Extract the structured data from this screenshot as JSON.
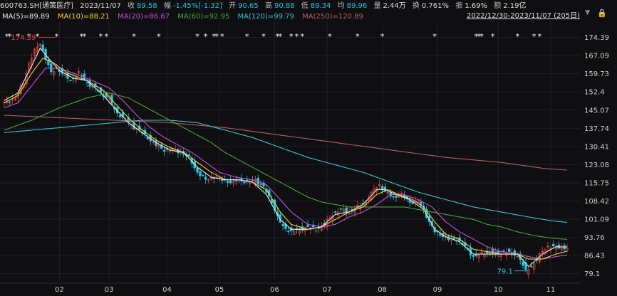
{
  "header": {
    "symbol": "600763.SH[通策医疗]",
    "date": "2023/11/07",
    "close_label": "收",
    "close": "89.58",
    "change_label": "幅",
    "change": "-1.45%[-1.32]",
    "open_label": "开",
    "open": "90.65",
    "high_label": "高",
    "high": "90.88",
    "low_label": "低",
    "low": "89.34",
    "avg_label": "均",
    "avg": "89.96",
    "vol_label": "量",
    "vol": "2.44万",
    "turnover_label": "换",
    "turnover": "0.761%",
    "amp_label": "振",
    "amp": "1.69%",
    "amount_label": "额",
    "amount": "2.19亿"
  },
  "range": {
    "label": "2022/12/30-2023/11/07 (205日)"
  },
  "icons": {
    "dropdown": "triangle-down-icon",
    "lock": "lock-icon"
  },
  "colors": {
    "up": "#e2473b",
    "down": "#22c5dc",
    "ma5": "#e6e6e6",
    "ma10": "#f0d23c",
    "ma20": "#c94fd8",
    "ma60": "#4da33a",
    "ma120": "#3cc3cf",
    "ma250": "#b86060",
    "background": "#0f0f12"
  },
  "chart_data": {
    "type": "candlestick",
    "ylim": [
      77,
      178
    ],
    "yticks": [
      "174.39",
      "167.09",
      "159.73",
      "152.4",
      "145.07",
      "137.74",
      "130.41",
      "123.08",
      "115.75",
      "108.42",
      "101.09",
      "93.76",
      "86.43",
      "79.1"
    ],
    "xticks": [
      {
        "label": "02",
        "x": 20
      },
      {
        "label": "03",
        "x": 38
      },
      {
        "label": "04",
        "x": 59
      },
      {
        "label": "05",
        "x": 78
      },
      {
        "label": "06",
        "x": 98
      },
      {
        "label": "07",
        "x": 117
      },
      {
        "label": "08",
        "x": 137
      },
      {
        "label": "09",
        "x": 157
      },
      {
        "label": "10",
        "x": 179
      },
      {
        "label": "11",
        "x": 198
      }
    ],
    "annotations": [
      {
        "text": "174.39",
        "x": 12,
        "y": 174.39,
        "color": "#e2473b"
      },
      {
        "text": "79.1",
        "x": 190,
        "y": 79.1,
        "color": "#22c5dc"
      }
    ],
    "event_markers_x": [
      1,
      2,
      5,
      9,
      12,
      19,
      28,
      29,
      35,
      37,
      47,
      56,
      70,
      73,
      76,
      77,
      79,
      88,
      94,
      99,
      100,
      104,
      106,
      108,
      118,
      128,
      137,
      156,
      171,
      172,
      173,
      177,
      186,
      192,
      194
    ],
    "ma_legend": [
      {
        "name": "MA(5)",
        "value": "89.89"
      },
      {
        "name": "MA(10)",
        "value": "88.21"
      },
      {
        "name": "MA(20)",
        "value": "86.67"
      },
      {
        "name": "MA(60)",
        "value": "92.95"
      },
      {
        "name": "MA(120)",
        "value": "99.79"
      },
      {
        "name": "MA(250)",
        "value": "120.89"
      }
    ],
    "close_anchors": [
      [
        0,
        148
      ],
      [
        4,
        150
      ],
      [
        7,
        156
      ],
      [
        9,
        164
      ],
      [
        11,
        169
      ],
      [
        13,
        172
      ],
      [
        15,
        166
      ],
      [
        17,
        160
      ],
      [
        19,
        162
      ],
      [
        21,
        160
      ],
      [
        24,
        157
      ],
      [
        27,
        160
      ],
      [
        30,
        156
      ],
      [
        33,
        154
      ],
      [
        36,
        151
      ],
      [
        38,
        150
      ],
      [
        40,
        145
      ],
      [
        43,
        142
      ],
      [
        46,
        139
      ],
      [
        49,
        137
      ],
      [
        52,
        134
      ],
      [
        55,
        131
      ],
      [
        58,
        129
      ],
      [
        61,
        129
      ],
      [
        64,
        128
      ],
      [
        67,
        126
      ],
      [
        70,
        120
      ],
      [
        73,
        117
      ],
      [
        76,
        118
      ],
      [
        79,
        117
      ],
      [
        82,
        116
      ],
      [
        85,
        117
      ],
      [
        88,
        116
      ],
      [
        91,
        117
      ],
      [
        94,
        114
      ],
      [
        97,
        108
      ],
      [
        99,
        102
      ],
      [
        101,
        98
      ],
      [
        104,
        96
      ],
      [
        107,
        97
      ],
      [
        110,
        98
      ],
      [
        113,
        97
      ],
      [
        116,
        99
      ],
      [
        119,
        103
      ],
      [
        122,
        105
      ],
      [
        125,
        104
      ],
      [
        128,
        106
      ],
      [
        131,
        108
      ],
      [
        134,
        113
      ],
      [
        136,
        115
      ],
      [
        138,
        112
      ],
      [
        141,
        110
      ],
      [
        144,
        111
      ],
      [
        147,
        108
      ],
      [
        150,
        108
      ],
      [
        152,
        105
      ],
      [
        154,
        100
      ],
      [
        156,
        96
      ],
      [
        158,
        95
      ],
      [
        161,
        93
      ],
      [
        164,
        93
      ],
      [
        167,
        90
      ],
      [
        170,
        86
      ],
      [
        173,
        87
      ],
      [
        176,
        88
      ],
      [
        179,
        87
      ],
      [
        182,
        88
      ],
      [
        185,
        87
      ],
      [
        187,
        85
      ],
      [
        189,
        80
      ],
      [
        191,
        82
      ],
      [
        193,
        85
      ],
      [
        195,
        88
      ],
      [
        197,
        90
      ],
      [
        199,
        90
      ],
      [
        201,
        89.6
      ],
      [
        204,
        89.58
      ]
    ],
    "ma5_anchors": [
      [
        0,
        149
      ],
      [
        5,
        152
      ],
      [
        10,
        163
      ],
      [
        13,
        170
      ],
      [
        16,
        166
      ],
      [
        20,
        161
      ],
      [
        25,
        158
      ],
      [
        30,
        157
      ],
      [
        35,
        152
      ],
      [
        40,
        146
      ],
      [
        45,
        140
      ],
      [
        50,
        136
      ],
      [
        55,
        132
      ],
      [
        60,
        129
      ],
      [
        65,
        128
      ],
      [
        70,
        122
      ],
      [
        75,
        118
      ],
      [
        80,
        117
      ],
      [
        85,
        117
      ],
      [
        90,
        116
      ],
      [
        95,
        111
      ],
      [
        100,
        101
      ],
      [
        104,
        97
      ],
      [
        110,
        97
      ],
      [
        115,
        98
      ],
      [
        120,
        103
      ],
      [
        125,
        104
      ],
      [
        130,
        107
      ],
      [
        135,
        113
      ],
      [
        138,
        113
      ],
      [
        142,
        111
      ],
      [
        147,
        109
      ],
      [
        152,
        105
      ],
      [
        156,
        97
      ],
      [
        160,
        94
      ],
      [
        165,
        92
      ],
      [
        170,
        87
      ],
      [
        175,
        87
      ],
      [
        180,
        87
      ],
      [
        186,
        87
      ],
      [
        190,
        82
      ],
      [
        195,
        87
      ],
      [
        200,
        90
      ],
      [
        204,
        89.89
      ]
    ],
    "ma10_anchors": [
      [
        0,
        148
      ],
      [
        5,
        151
      ],
      [
        10,
        160
      ],
      [
        14,
        166
      ],
      [
        18,
        164
      ],
      [
        23,
        160
      ],
      [
        30,
        157
      ],
      [
        36,
        153
      ],
      [
        40,
        148
      ],
      [
        45,
        142
      ],
      [
        50,
        137
      ],
      [
        55,
        133
      ],
      [
        60,
        130
      ],
      [
        65,
        128
      ],
      [
        70,
        124
      ],
      [
        75,
        120
      ],
      [
        80,
        117
      ],
      [
        85,
        117
      ],
      [
        90,
        116
      ],
      [
        95,
        113
      ],
      [
        100,
        104
      ],
      [
        104,
        99
      ],
      [
        110,
        97
      ],
      [
        115,
        98
      ],
      [
        120,
        101
      ],
      [
        125,
        104
      ],
      [
        130,
        106
      ],
      [
        135,
        111
      ],
      [
        139,
        113
      ],
      [
        143,
        111
      ],
      [
        148,
        109
      ],
      [
        152,
        106
      ],
      [
        156,
        100
      ],
      [
        160,
        95
      ],
      [
        165,
        93
      ],
      [
        170,
        89
      ],
      [
        175,
        88
      ],
      [
        180,
        87
      ],
      [
        186,
        87
      ],
      [
        190,
        85
      ],
      [
        195,
        85
      ],
      [
        200,
        87
      ],
      [
        204,
        88.21
      ]
    ],
    "ma20_anchors": [
      [
        0,
        146
      ],
      [
        5,
        148
      ],
      [
        10,
        155
      ],
      [
        15,
        162
      ],
      [
        20,
        162
      ],
      [
        25,
        160
      ],
      [
        32,
        157
      ],
      [
        38,
        154
      ],
      [
        43,
        149
      ],
      [
        48,
        143
      ],
      [
        53,
        138
      ],
      [
        58,
        134
      ],
      [
        63,
        131
      ],
      [
        68,
        128
      ],
      [
        73,
        124
      ],
      [
        78,
        120
      ],
      [
        84,
        118
      ],
      [
        90,
        117
      ],
      [
        95,
        115
      ],
      [
        100,
        109
      ],
      [
        104,
        104
      ],
      [
        110,
        99
      ],
      [
        115,
        98
      ],
      [
        120,
        99
      ],
      [
        125,
        102
      ],
      [
        130,
        104
      ],
      [
        135,
        107
      ],
      [
        140,
        111
      ],
      [
        145,
        111
      ],
      [
        150,
        109
      ],
      [
        155,
        106
      ],
      [
        160,
        100
      ],
      [
        165,
        96
      ],
      [
        170,
        93
      ],
      [
        175,
        90
      ],
      [
        180,
        88
      ],
      [
        186,
        87
      ],
      [
        190,
        86
      ],
      [
        195,
        85
      ],
      [
        200,
        86
      ],
      [
        204,
        86.67
      ]
    ],
    "ma60_anchors": [
      [
        0,
        137
      ],
      [
        10,
        141
      ],
      [
        20,
        146
      ],
      [
        30,
        150
      ],
      [
        38,
        152
      ],
      [
        45,
        150
      ],
      [
        50,
        147
      ],
      [
        55,
        144
      ],
      [
        60,
        141
      ],
      [
        65,
        138
      ],
      [
        70,
        135
      ],
      [
        75,
        132
      ],
      [
        80,
        128
      ],
      [
        85,
        125
      ],
      [
        90,
        122
      ],
      [
        95,
        119
      ],
      [
        100,
        116
      ],
      [
        105,
        113
      ],
      [
        110,
        110
      ],
      [
        115,
        108
      ],
      [
        120,
        107
      ],
      [
        125,
        106
      ],
      [
        130,
        106
      ],
      [
        135,
        106
      ],
      [
        140,
        106
      ],
      [
        145,
        106
      ],
      [
        150,
        105
      ],
      [
        155,
        104
      ],
      [
        160,
        103
      ],
      [
        165,
        102
      ],
      [
        170,
        101
      ],
      [
        175,
        99
      ],
      [
        180,
        98
      ],
      [
        186,
        96
      ],
      [
        192,
        94.5
      ],
      [
        198,
        93.5
      ],
      [
        204,
        92.95
      ]
    ],
    "ma120_anchors": [
      [
        0,
        136
      ],
      [
        20,
        138
      ],
      [
        40,
        140
      ],
      [
        50,
        141
      ],
      [
        60,
        141
      ],
      [
        70,
        140
      ],
      [
        80,
        137
      ],
      [
        90,
        134
      ],
      [
        100,
        130
      ],
      [
        110,
        126
      ],
      [
        120,
        123
      ],
      [
        130,
        120
      ],
      [
        140,
        116
      ],
      [
        150,
        112
      ],
      [
        160,
        109
      ],
      [
        170,
        106
      ],
      [
        180,
        104
      ],
      [
        190,
        102
      ],
      [
        198,
        100.5
      ],
      [
        204,
        99.79
      ]
    ],
    "ma250_anchors": [
      [
        0,
        143
      ],
      [
        20,
        142
      ],
      [
        40,
        141
      ],
      [
        60,
        140
      ],
      [
        80,
        138
      ],
      [
        100,
        135
      ],
      [
        120,
        132
      ],
      [
        140,
        129
      ],
      [
        160,
        126
      ],
      [
        180,
        124
      ],
      [
        196,
        121.5
      ],
      [
        204,
        120.89
      ]
    ]
  }
}
